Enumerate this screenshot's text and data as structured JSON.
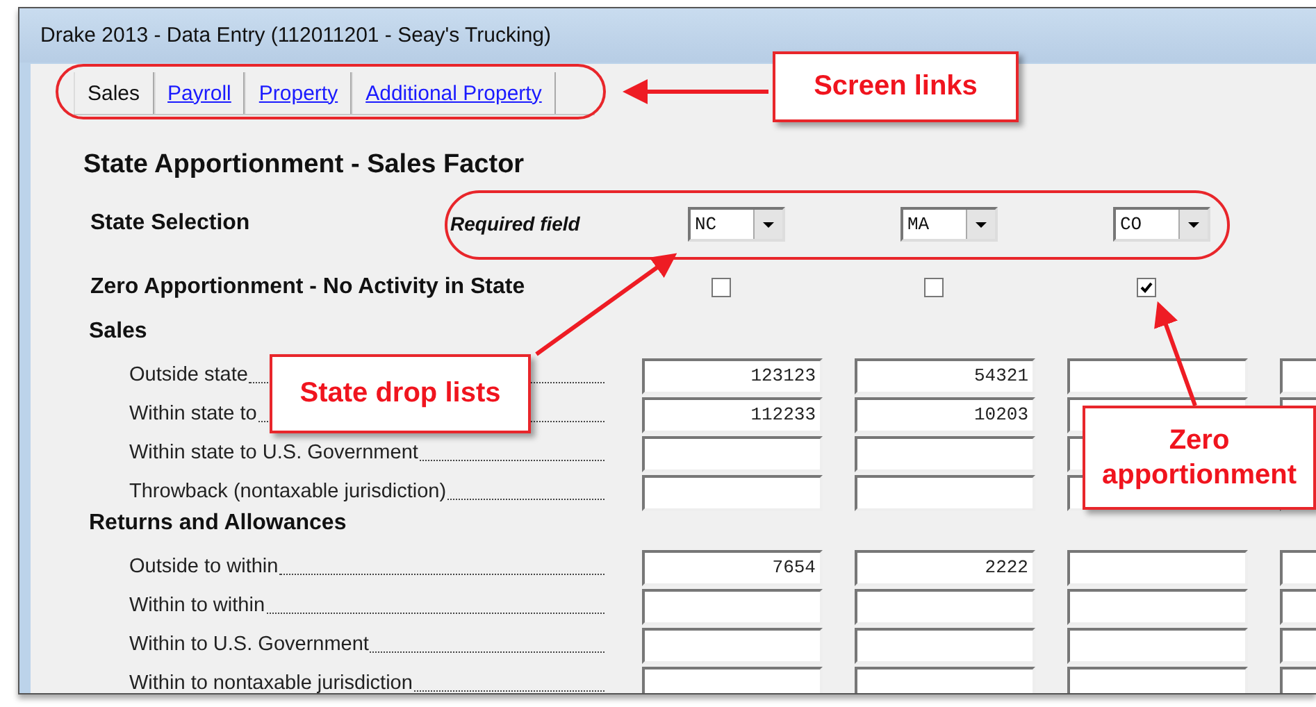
{
  "window": {
    "title": "Drake 2013 - Data Entry (112011201 - Seay's Trucking)"
  },
  "tabs": [
    {
      "label": "Sales",
      "selected": true
    },
    {
      "label": "Payroll",
      "selected": false
    },
    {
      "label": "Property",
      "selected": false
    },
    {
      "label": "Additional Property",
      "selected": false
    }
  ],
  "heading": "State Apportionment - Sales Factor",
  "state_selection": {
    "label": "State Selection",
    "hint": "Required field",
    "dropdowns": [
      {
        "value": "NC"
      },
      {
        "value": "MA"
      },
      {
        "value": "CO"
      }
    ]
  },
  "zero_apportionment": {
    "label": "Zero Apportionment - No Activity in State",
    "checkboxes": [
      {
        "checked": false
      },
      {
        "checked": false
      },
      {
        "checked": true
      }
    ]
  },
  "sections": [
    {
      "title": "Sales",
      "rows": [
        {
          "label": "Outside state",
          "values": [
            "123123",
            "54321"
          ]
        },
        {
          "label": "Within state to",
          "values": [
            "112233",
            "10203"
          ]
        },
        {
          "label": "Within state to U.S. Government"
        },
        {
          "label": "Throwback (nontaxable jurisdiction)"
        }
      ]
    },
    {
      "title": "Returns and Allowances",
      "rows": [
        {
          "label": "Outside to within",
          "values": [
            "7654",
            "2222"
          ]
        },
        {
          "label": "Within to within"
        },
        {
          "label": "Within to U.S. Government"
        },
        {
          "label": "Within to nontaxable jurisdiction"
        }
      ]
    }
  ],
  "annotations": [
    {
      "text": "Screen links"
    },
    {
      "text": "State drop lists"
    },
    {
      "text": "Zero apportionment"
    }
  ]
}
